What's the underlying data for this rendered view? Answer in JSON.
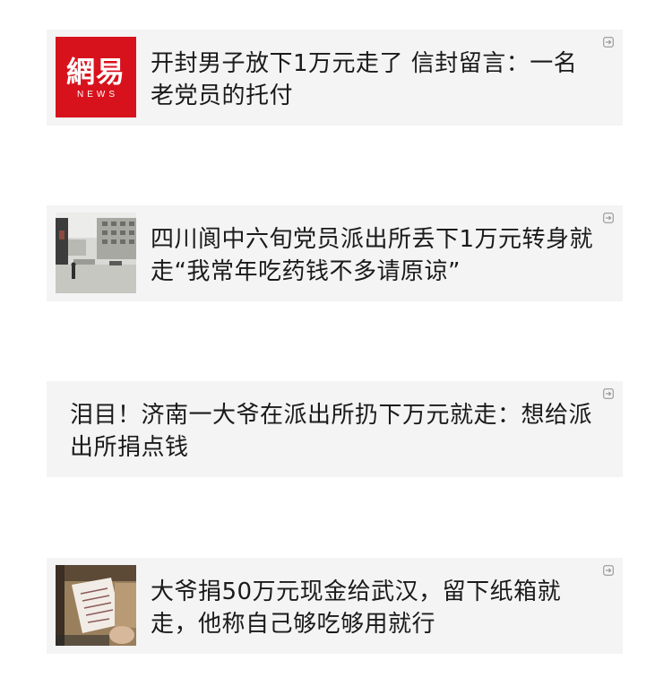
{
  "articles": [
    {
      "title": "开封男子放下1万元走了 信封留言：一名老党员的托付",
      "thumbnail": "netease-news-logo",
      "logo_text": "網易",
      "logo_sub": "NEWS"
    },
    {
      "title": "四川阆中六旬党员派出所丢下1万元转身就走“我常年吃药钱不多请原谅”",
      "thumbnail": "street-photo"
    },
    {
      "title": "泪目！济南一大爷在派出所扔下万元就走：想给派出所捐点钱",
      "thumbnail": null
    },
    {
      "title": "大爷捐50万元现金给武汉，留下纸箱就走，他称自己够吃够用就行",
      "thumbnail": "handwritten-note-photo"
    }
  ],
  "icons": {
    "external": "share-arrow-icon"
  },
  "colors": {
    "card_background": "#f4f4f4",
    "page_background": "#ffffff",
    "title_text": "#1a1a1a",
    "netease_red": "#d8121d",
    "icon_gray": "#8a8a8a"
  }
}
